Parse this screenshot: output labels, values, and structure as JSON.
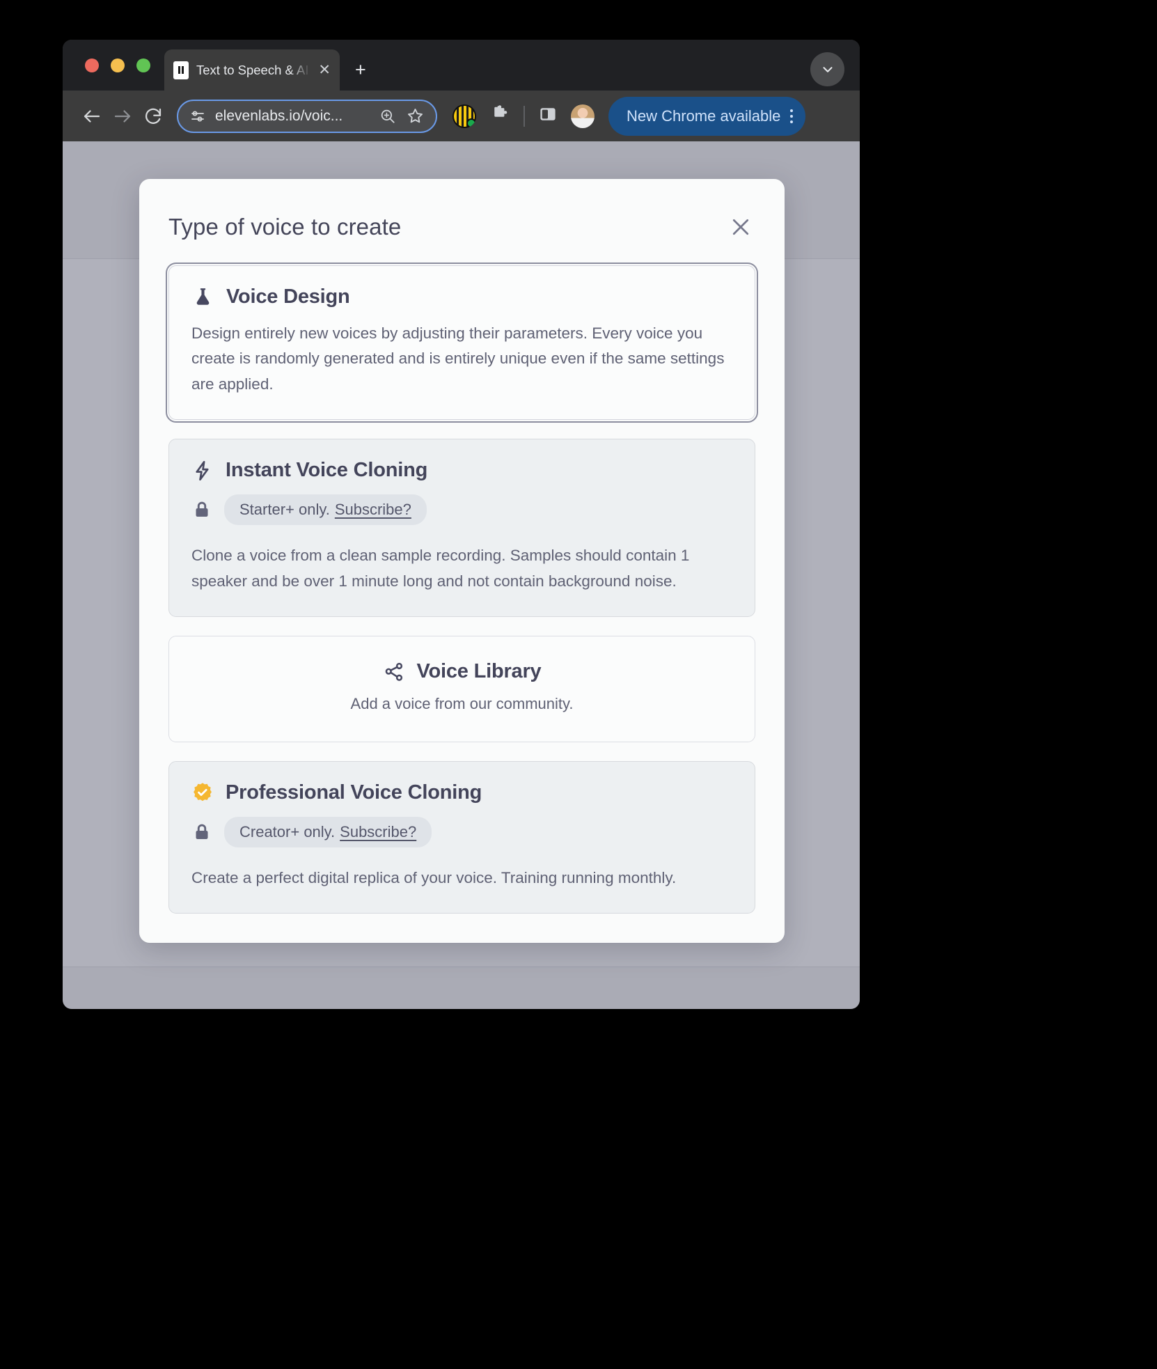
{
  "browser": {
    "tab": {
      "title": "Text to Speech & AI Voice Ge",
      "favicon_name": "pause-bars-favicon",
      "close_label": "✕"
    },
    "new_tab_label": "+",
    "omnibox": {
      "url": "elevenlabs.io/voic...",
      "site_settings_icon": "tune-sliders-icon",
      "zoom_icon": "zoom-in-icon",
      "bookmark_icon": "star-icon"
    },
    "nav": {
      "back_icon": "arrow-left-icon",
      "forward_icon": "arrow-right-icon",
      "reload_icon": "reload-icon"
    },
    "toolbar_icons": [
      "extension-maze-icon",
      "puzzle-extensions-icon",
      "side-panel-icon",
      "profile-avatar"
    ],
    "update_button": {
      "label": "New Chrome available",
      "menu_icon": "kebab-menu-icon",
      "color": "#1a5089"
    },
    "tab_list_icon": "chevron-down-icon"
  },
  "modal": {
    "title": "Type of voice to create",
    "close_icon": "close-icon",
    "options": [
      {
        "id": "voice-design",
        "icon": "flask-icon",
        "title": "Voice Design",
        "description": "Design entirely new voices by adjusting their parameters. Every voice you create is randomly generated and is entirely unique even if the same settings are applied.",
        "selected": true,
        "locked": false
      },
      {
        "id": "instant-voice-cloning",
        "icon": "lightning-bolt-icon",
        "title": "Instant Voice Cloning",
        "description": "Clone a voice from a clean sample recording. Samples should contain 1 speaker and be over 1 minute long and not contain background noise.",
        "selected": false,
        "locked": true,
        "lock_icon": "lock-icon",
        "badge_text": "Starter+ only.",
        "badge_link": "Subscribe?"
      },
      {
        "id": "voice-library",
        "icon": "share-network-icon",
        "title": "Voice Library",
        "description": "Add a voice from our community.",
        "selected": false,
        "locked": false
      },
      {
        "id": "professional-voice-cloning",
        "icon": "verified-badge-icon",
        "title": "Professional Voice Cloning",
        "description": "Create a perfect digital replica of your voice. Training running monthly.",
        "selected": false,
        "locked": true,
        "lock_icon": "lock-icon",
        "badge_text": "Creator+ only.",
        "badge_link": "Subscribe?"
      }
    ]
  },
  "colors": {
    "modal_bg": "#fafbfb",
    "page_overlay": "#aaabb5",
    "title_text": "#444559",
    "badge_bg": "#dfe3e8",
    "verified_badge": "#f5b731",
    "update_button": "#1a5089"
  }
}
